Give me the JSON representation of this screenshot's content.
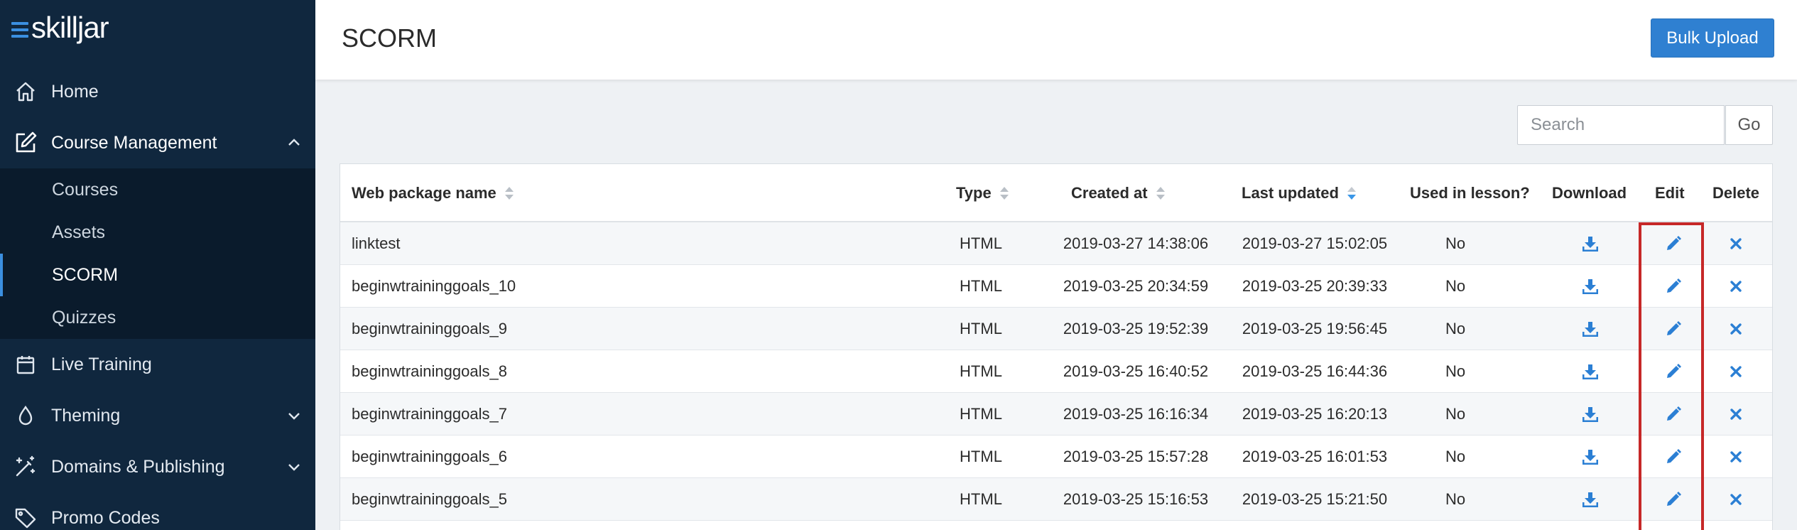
{
  "brand": {
    "name": "skilljar"
  },
  "sidebar": {
    "items": [
      {
        "label": "Home",
        "icon": "home-icon"
      },
      {
        "label": "Course Management",
        "icon": "edit-icon",
        "expanded": true
      },
      {
        "label": "Live Training",
        "icon": "calendar-icon"
      },
      {
        "label": "Theming",
        "icon": "droplet-icon"
      },
      {
        "label": "Domains & Publishing",
        "icon": "magic-wand-icon"
      },
      {
        "label": "Promo Codes",
        "icon": "tag-icon"
      }
    ],
    "submenu": [
      {
        "label": "Courses"
      },
      {
        "label": "Assets"
      },
      {
        "label": "SCORM",
        "selected": true
      },
      {
        "label": "Quizzes"
      }
    ]
  },
  "header": {
    "title": "SCORM",
    "bulk_upload": "Bulk Upload"
  },
  "search": {
    "placeholder": "Search",
    "go": "Go"
  },
  "table": {
    "columns": [
      "Web package name",
      "Type",
      "Created at",
      "Last updated",
      "Used in lesson?",
      "Download",
      "Edit",
      "Delete"
    ],
    "sorted_column": "Last updated",
    "rows": [
      {
        "name": "linktest",
        "type": "HTML",
        "created": "2019-03-27 14:38:06",
        "updated": "2019-03-27 15:02:05",
        "used": "No"
      },
      {
        "name": "beginwtraininggoals_10",
        "type": "HTML",
        "created": "2019-03-25 20:34:59",
        "updated": "2019-03-25 20:39:33",
        "used": "No"
      },
      {
        "name": "beginwtraininggoals_9",
        "type": "HTML",
        "created": "2019-03-25 19:52:39",
        "updated": "2019-03-25 19:56:45",
        "used": "No"
      },
      {
        "name": "beginwtraininggoals_8",
        "type": "HTML",
        "created": "2019-03-25 16:40:52",
        "updated": "2019-03-25 16:44:36",
        "used": "No"
      },
      {
        "name": "beginwtraininggoals_7",
        "type": "HTML",
        "created": "2019-03-25 16:16:34",
        "updated": "2019-03-25 16:20:13",
        "used": "No"
      },
      {
        "name": "beginwtraininggoals_6",
        "type": "HTML",
        "created": "2019-03-25 15:57:28",
        "updated": "2019-03-25 16:01:53",
        "used": "No"
      },
      {
        "name": "beginwtraininggoals_5",
        "type": "HTML",
        "created": "2019-03-25 15:16:53",
        "updated": "2019-03-25 15:21:50",
        "used": "No"
      }
    ]
  },
  "colors": {
    "sidebar_bg": "#10273e",
    "accent": "#2f80d1",
    "highlight": "#c62828",
    "action_icon": "#2b7fd4"
  }
}
